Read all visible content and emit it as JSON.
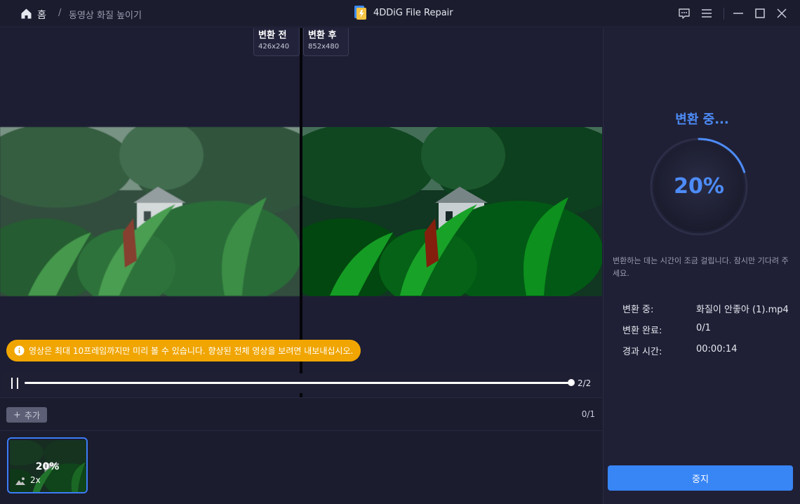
{
  "app": {
    "title": "4DDiG File Repair"
  },
  "breadcrumb": {
    "home": "홈",
    "separator": "/",
    "current": "동영상 화질 높이기"
  },
  "titlebar": {
    "icons": [
      "feedback-icon",
      "menu-icon",
      "minimize-icon",
      "maximize-icon",
      "close-icon"
    ]
  },
  "preview": {
    "before_label": "변환 전",
    "before_res": "426x240",
    "after_label": "변환 후",
    "after_res": "852x480",
    "notice": "영상은 최대 10프레임까지만 미리 볼 수 있습니다. 향상된 전체 영상을 보려면 내보내십시오.",
    "frames": "2/2",
    "playback_progress": 1.0
  },
  "filebar": {
    "add_label": "추가",
    "count": "0/1"
  },
  "thumbnail": {
    "percent": "20%",
    "scale": "2x"
  },
  "panel": {
    "title": "변환 중...",
    "percent": "20%",
    "progress": 0.2,
    "note": "변환하는 데는 시간이 조금 걸립니다. 잠시만 기다려 주세요.",
    "rows": [
      {
        "label": "변환 중:",
        "value": "화질이 안좋아 (1).mp4"
      },
      {
        "label": "변환 완료:",
        "value": "0/1"
      },
      {
        "label": "경과 시간:",
        "value": "00:00:14"
      }
    ],
    "stop_label": "중지"
  },
  "colors": {
    "accent": "#3885f6",
    "progress_text": "#4d8cf8",
    "notice_bg": "#f0a500",
    "background": "#1b1c2e"
  }
}
